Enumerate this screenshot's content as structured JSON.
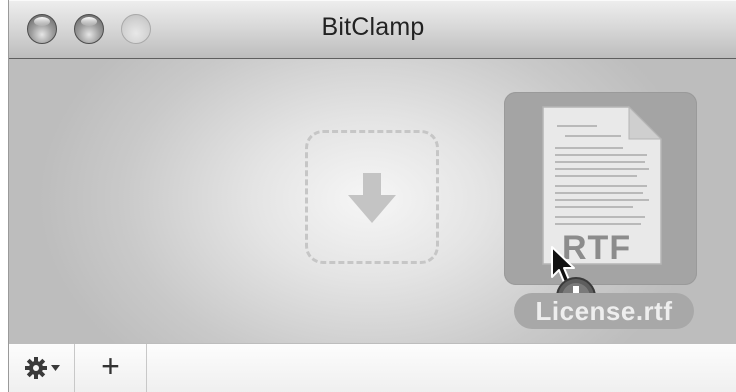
{
  "window": {
    "title": "BitClamp"
  },
  "titlebar": {
    "buttons": [
      "close",
      "minimize",
      "zoom"
    ]
  },
  "dropzone": {
    "icon": "download-arrow-icon"
  },
  "dragged_file": {
    "name": "License.rtf",
    "kind_label": "RTF",
    "icon": "rtf-document-icon",
    "operation_badge": "copy-plus-icon"
  },
  "toolbar": {
    "gear_icon": "gear-icon",
    "add_label": "+"
  },
  "colors": {
    "content_highlight": "#f6f6f6",
    "content_edge": "#bdbdbd",
    "file_tile": "#a4a4a4",
    "dropzone_border": "#c6c6c6"
  }
}
